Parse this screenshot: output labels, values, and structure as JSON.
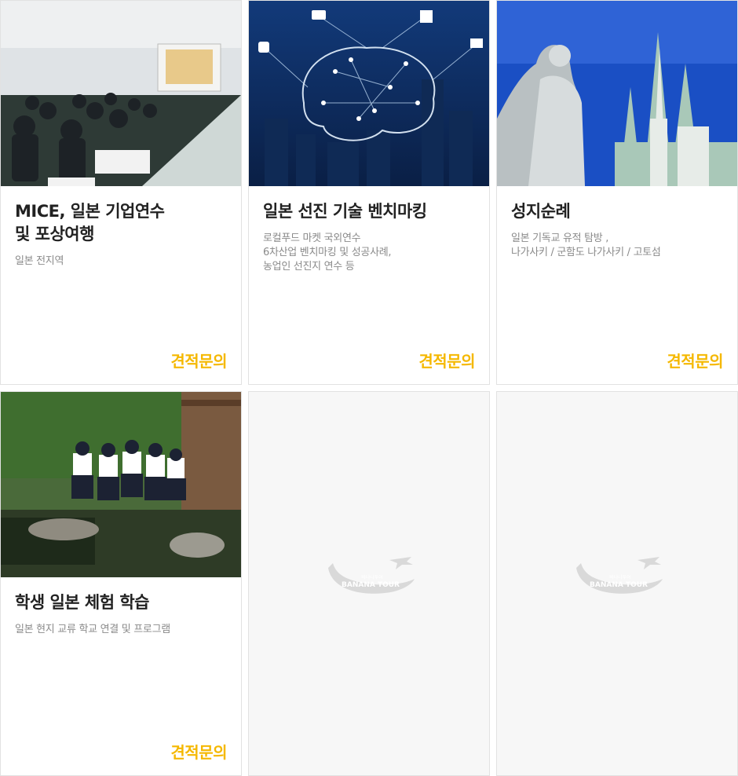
{
  "cards": [
    {
      "title_lines": [
        "MICE, 일본 기업연수",
        "및 포상여행"
      ],
      "desc_lines": [
        "일본 전지역"
      ],
      "inquiry": "견적문의",
      "image": "seminar-photo"
    },
    {
      "title_lines": [
        "일본 선진 기술 벤치마킹"
      ],
      "desc_lines": [
        "로컬푸드 마켓 국외연수",
        "6차산업 벤치마킹 및 성공사례,",
        "농업인 선진지 연수 등"
      ],
      "inquiry": "견적문의",
      "image": "ai-brain-network-photo"
    },
    {
      "title_lines": [
        "성지순례"
      ],
      "desc_lines": [
        "일본 기독교 유적 탐방 ,",
        "나가사키 / 군함도 나가사키 / 고토섬"
      ],
      "inquiry": "견적문의",
      "image": "church-statue-photo"
    },
    {
      "title_lines": [
        "학생 일본 체험 학습"
      ],
      "desc_lines": [
        "일본 현지 교류 학교 연결 및 프로그램"
      ],
      "inquiry": "견적문의",
      "image": "students-garden-photo"
    }
  ],
  "placeholders": [
    {
      "logo_small": "바나나투어",
      "logo_main": "BANANA TOUR"
    },
    {
      "logo_small": "바나나투어",
      "logo_main": "BANANA TOUR"
    }
  ],
  "colors": {
    "accent": "#f5b800",
    "title": "#222222",
    "desc": "#8a8a8a",
    "border": "#e2e2e2"
  }
}
